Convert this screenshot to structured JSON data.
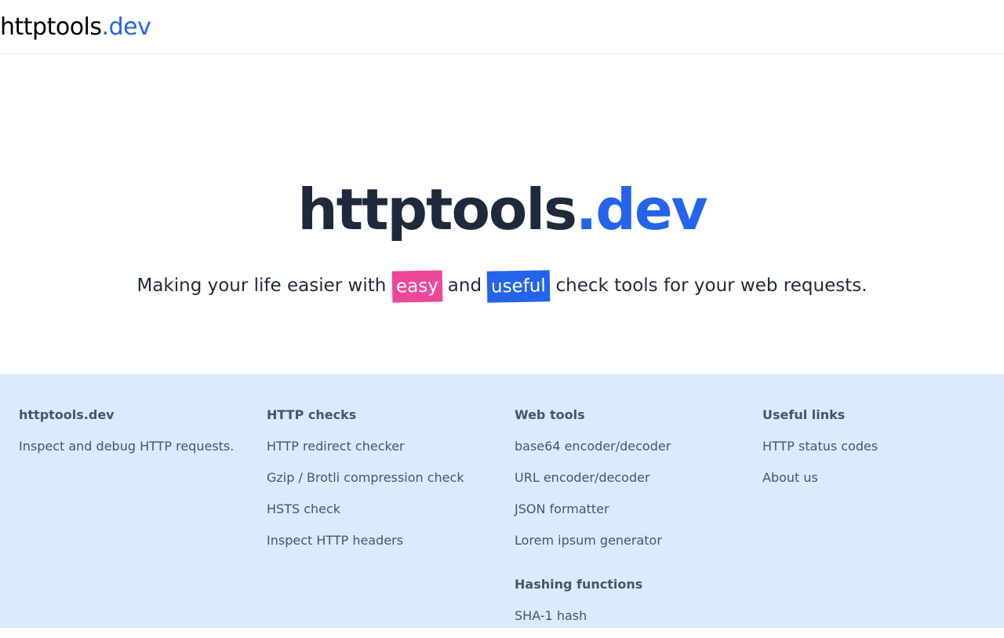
{
  "header": {
    "brand_name": "httptools",
    "brand_tld": ".dev"
  },
  "hero": {
    "title_name": "httptools",
    "title_tld": ".dev",
    "tagline_before": "Making your life easier with ",
    "highlight_1": "easy",
    "tagline_middle": " and ",
    "highlight_2": "useful",
    "tagline_after": " check tools for your web requests.",
    "highlight_colors": {
      "easy": "#ec4899",
      "useful": "#2563eb"
    }
  },
  "footer": {
    "about": {
      "heading": "httptools.dev",
      "text": "Inspect and debug HTTP requests."
    },
    "http_checks": {
      "heading": "HTTP checks",
      "links": [
        "HTTP redirect checker",
        "Gzip / Brotli compression check",
        "HSTS check",
        "Inspect HTTP headers"
      ]
    },
    "web_tools": {
      "heading": "Web tools",
      "links": [
        "base64 encoder/decoder",
        "URL encoder/decoder",
        "JSON formatter",
        "Lorem ipsum generator"
      ]
    },
    "hashing": {
      "heading": "Hashing functions",
      "links": [
        "SHA-1 hash"
      ]
    },
    "useful_links": {
      "heading": "Useful links",
      "links": [
        "HTTP status codes",
        "About us"
      ]
    }
  },
  "colors": {
    "accent": "#2563eb",
    "footer_bg": "#dbeafe",
    "text_dark": "#1e293b",
    "text_muted": "#475569"
  }
}
